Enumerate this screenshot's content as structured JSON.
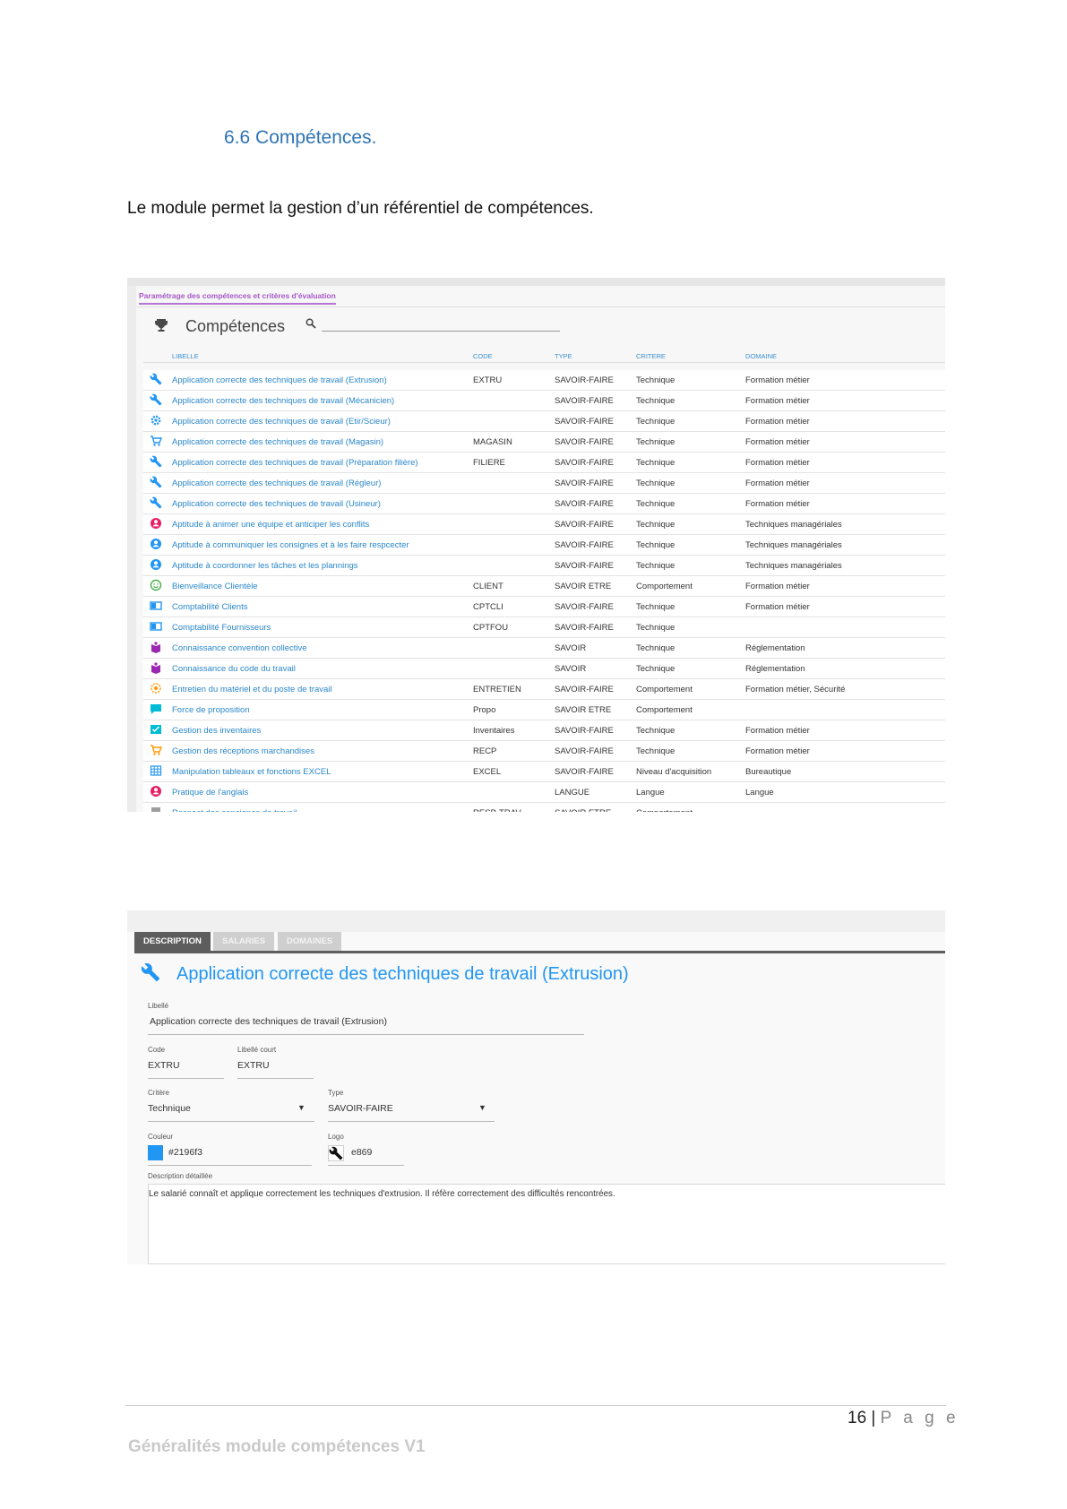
{
  "section_heading": "6.6 Compétences.",
  "intro": "Le module permet la gestion d’un référentiel de compétences.",
  "list_screen": {
    "breadcrumb_tab": "Paramétrage des compétences et critères d'évaluation",
    "title": "Compétences",
    "search": {
      "placeholder": "",
      "icon": "search-icon"
    },
    "columns": {
      "libelle": "LIBELLE",
      "code": "CODE",
      "type": "TYPE",
      "critere": "CRITERE",
      "domaine": "DOMAINE"
    },
    "rows": [
      {
        "icon": "wrench-icon",
        "color": "#2196f3",
        "libelle": "Application correcte des techniques de travail (Extrusion)",
        "code": "EXTRU",
        "type": "SAVOIR-FAIRE",
        "critere": "Technique",
        "domaine": "Formation métier"
      },
      {
        "icon": "wrench-icon",
        "color": "#2196f3",
        "libelle": "Application correcte des techniques de travail (Mécanicien)",
        "code": "",
        "type": "SAVOIR-FAIRE",
        "critere": "Technique",
        "domaine": "Formation métier"
      },
      {
        "icon": "gear-icon",
        "color": "#2196f3",
        "libelle": "Application correcte des techniques de travail (Etir/Scieur)",
        "code": "",
        "type": "SAVOIR-FAIRE",
        "critere": "Technique",
        "domaine": "Formation métier"
      },
      {
        "icon": "cart-icon",
        "color": "#2196f3",
        "libelle": "Application correcte des techniques de travail (Magasin)",
        "code": "MAGASIN",
        "type": "SAVOIR-FAIRE",
        "critere": "Technique",
        "domaine": "Formation métier"
      },
      {
        "icon": "wrench-icon",
        "color": "#2196f3",
        "libelle": "Application correcte des techniques de travail (Préparation filière)",
        "code": "FILIERE",
        "type": "SAVOIR-FAIRE",
        "critere": "Technique",
        "domaine": "Formation métier"
      },
      {
        "icon": "wrench-icon",
        "color": "#2196f3",
        "libelle": "Application correcte des techniques de travail (Régleur)",
        "code": "",
        "type": "SAVOIR-FAIRE",
        "critere": "Technique",
        "domaine": "Formation métier"
      },
      {
        "icon": "wrench-icon",
        "color": "#2196f3",
        "libelle": "Application correcte des techniques de travail (Usineur)",
        "code": "",
        "type": "SAVOIR-FAIRE",
        "critere": "Technique",
        "domaine": "Formation métier"
      },
      {
        "icon": "user-circle-icon",
        "color": "#e91e63",
        "libelle": "Aptitude à animer une équipe et anticiper les conflits",
        "code": "",
        "type": "SAVOIR-FAIRE",
        "critere": "Technique",
        "domaine": "Techniques managériales"
      },
      {
        "icon": "user-circle-icon",
        "color": "#2196f3",
        "libelle": "Aptitude à communiquer les consignes et à les faire respcecter",
        "code": "",
        "type": "SAVOIR-FAIRE",
        "critere": "Technique",
        "domaine": "Techniques managériales"
      },
      {
        "icon": "user-circle-icon",
        "color": "#2196f3",
        "libelle": "Aptitude à coordonner les tâches et les plannings",
        "code": "",
        "type": "SAVOIR-FAIRE",
        "critere": "Technique",
        "domaine": "Techniques managériales"
      },
      {
        "icon": "smiley-icon",
        "color": "#4caf50",
        "libelle": "Bienveillance Clientèle",
        "code": "CLIENT",
        "type": "SAVOIR ETRE",
        "critere": "Comportement",
        "domaine": "Formation métier"
      },
      {
        "icon": "card-icon",
        "color": "#2196f3",
        "libelle": "Comptabilité Clients",
        "code": "CPTCLI",
        "type": "SAVOIR-FAIRE",
        "critere": "Technique",
        "domaine": "Formation métier"
      },
      {
        "icon": "card-icon",
        "color": "#2196f3",
        "libelle": "Comptabilité Fournisseurs",
        "code": "CPTFOU",
        "type": "SAVOIR-FAIRE",
        "critere": "Technique",
        "domaine": ""
      },
      {
        "icon": "book-icon",
        "color": "#9c27b0",
        "libelle": "Connaissance convention collective",
        "code": "",
        "type": "SAVOIR",
        "critere": "Technique",
        "domaine": "Réglementation"
      },
      {
        "icon": "book-icon",
        "color": "#9c27b0",
        "libelle": "Connaissance du code du travail",
        "code": "",
        "type": "SAVOIR",
        "critere": "Technique",
        "domaine": "Réglementation"
      },
      {
        "icon": "target-icon",
        "color": "#ff9800",
        "libelle": "Entretien du matériel et du poste de travail",
        "code": "ENTRETIEN",
        "type": "SAVOIR-FAIRE",
        "critere": "Comportement",
        "domaine": "Formation métier, Sécurité"
      },
      {
        "icon": "chat-icon",
        "color": "#00bcd4",
        "libelle": "Force de proposition",
        "code": "Propo",
        "type": "SAVOIR ETRE",
        "critere": "Comportement",
        "domaine": ""
      },
      {
        "icon": "inventory-icon",
        "color": "#00bcd4",
        "libelle": "Gestion des inventaires",
        "code": "Inventaires",
        "type": "SAVOIR-FAIRE",
        "critere": "Technique",
        "domaine": "Formation métier"
      },
      {
        "icon": "cart-icon",
        "color": "#ff9800",
        "libelle": "Gestion des réceptions marchandises",
        "code": "RECP",
        "type": "SAVOIR-FAIRE",
        "critere": "Technique",
        "domaine": "Formation métier"
      },
      {
        "icon": "grid-icon",
        "color": "#2196f3",
        "libelle": "Manipulation tableaux et fonctions EXCEL",
        "code": "EXCEL",
        "type": "SAVOIR-FAIRE",
        "critere": "Niveau d'acquisition",
        "domaine": "Bureautique"
      },
      {
        "icon": "user-circle-icon",
        "color": "#e91e63",
        "libelle": "Pratique de l'anglais",
        "code": "",
        "type": "LANGUE",
        "critere": "Langue",
        "domaine": "Langue"
      },
      {
        "icon": "flag-comment-icon",
        "color": "#9e9e9e",
        "libelle": "Respect des consignes de travail",
        "code": "RESP-TRAV",
        "type": "SAVOIR ETRE",
        "critere": "Comportement",
        "domaine": ""
      }
    ]
  },
  "detail_screen": {
    "tabs": [
      "DESCRIPTION",
      "SALARIES",
      "DOMAINES"
    ],
    "active_tab": "DESCRIPTION",
    "title": "Application correcte des techniques de travail (Extrusion)",
    "title_icon": "wrench-icon",
    "fields": {
      "libelle": {
        "label": "Libellé",
        "value": "Application correcte des techniques de travail (Extrusion)"
      },
      "code": {
        "label": "Code",
        "value": "EXTRU"
      },
      "libelle_court": {
        "label": "Libellé court",
        "value": "EXTRU"
      },
      "critere": {
        "label": "Critère",
        "value": "Technique"
      },
      "type": {
        "label": "Type",
        "value": "SAVOIR-FAIRE"
      },
      "couleur": {
        "label": "Couleur",
        "value": "#2196f3"
      },
      "logo": {
        "label": "Logo",
        "value": "e869",
        "icon": "wrench-icon"
      },
      "description": {
        "label": "Description détaillée",
        "value": "Le salarié connaît et applique correctement les techniques d'extrusion. Il réfère correctement des difficultés rencontrées."
      }
    }
  },
  "footer": {
    "page_number": "16",
    "page_word": "P a g e",
    "doc_title": "Généralités module compétences V1"
  }
}
